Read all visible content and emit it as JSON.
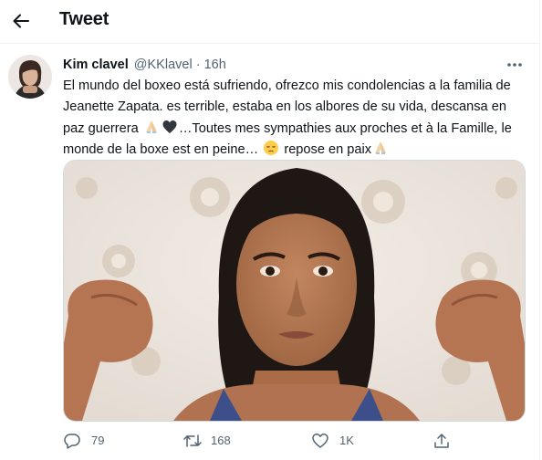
{
  "header": {
    "title": "Tweet",
    "back_icon": "arrow-left-icon"
  },
  "tweet": {
    "author_name": "Kim clavel",
    "handle": "@KKlavel",
    "separator": "·",
    "time": "16h",
    "text_lines": [
      "El mundo del boxeo está sufriendo, ofrezco mis condolencias a la familia de",
      "Jeanette Zapata. es terrible, estaba en los albores de su vida, descansa en",
      "…Toutes mes sympathies aux proches et à la Famille, le",
      "monde de la boxe est en peine…",
      "repose en paix"
    ],
    "text_line3_prefix": "paz guerrera",
    "emojis": [
      "folded-hands-icon",
      "black-heart-icon",
      "pensive-face-icon",
      "folded-hands-icon"
    ]
  },
  "actions": {
    "reply": {
      "count": "79",
      "icon": "reply-icon"
    },
    "retweet": {
      "count": "168",
      "icon": "retweet-icon"
    },
    "like": {
      "count": "1K",
      "icon": "heart-icon"
    },
    "share": {
      "icon": "share-icon"
    }
  },
  "colors": {
    "text": "#0f1419",
    "secondary": "#536471",
    "border": "#cfd9de",
    "divider": "#eff3f4"
  }
}
